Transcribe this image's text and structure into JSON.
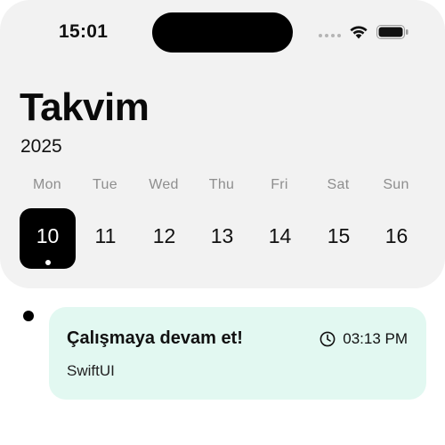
{
  "status_bar": {
    "time": "15:01",
    "icons": [
      "signal-dots-icon",
      "wifi-icon",
      "battery-icon"
    ]
  },
  "header": {
    "title": "Takvim",
    "year": "2025"
  },
  "week": {
    "days": [
      {
        "name": "Mon",
        "number": "10",
        "selected": true
      },
      {
        "name": "Tue",
        "number": "11",
        "selected": false
      },
      {
        "name": "Wed",
        "number": "12",
        "selected": false
      },
      {
        "name": "Thu",
        "number": "13",
        "selected": false
      },
      {
        "name": "Fri",
        "number": "14",
        "selected": false
      },
      {
        "name": "Sat",
        "number": "15",
        "selected": false
      },
      {
        "name": "Sun",
        "number": "16",
        "selected": false
      }
    ]
  },
  "tasks": [
    {
      "title": "Çalışmaya devam et!",
      "subtitle": "SwiftUI",
      "time": "03:13 PM",
      "icon": "clock-icon"
    }
  ],
  "colors": {
    "header_bg": "#f2f2f2",
    "selected_day_bg": "#000000",
    "task_card_bg": "#e2f8f1",
    "day_name_text": "#8e8e8e"
  }
}
